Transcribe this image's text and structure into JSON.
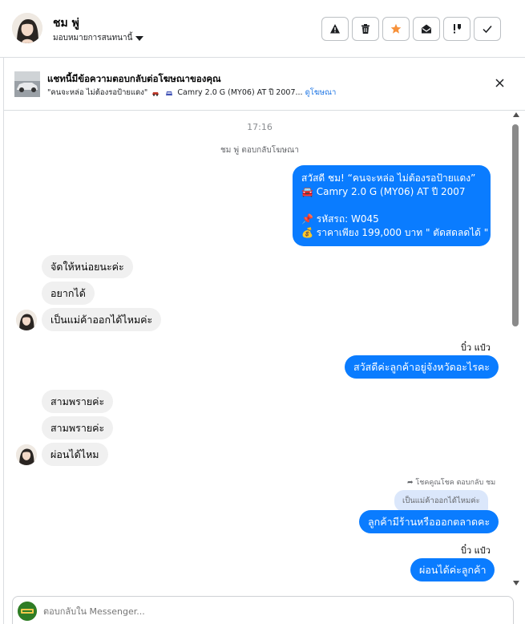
{
  "header": {
    "contact_name": "ชม พู่",
    "assign_label": "มอบหมายการสนทนานี้",
    "actions": [
      {
        "icon": "alert-triangle-icon",
        "name": "spam-button"
      },
      {
        "icon": "trash-icon",
        "name": "delete-button"
      },
      {
        "icon": "star-icon",
        "name": "star-button"
      },
      {
        "icon": "mark-unread-icon",
        "name": "mark-unread-button"
      },
      {
        "icon": "follow-up-icon",
        "name": "follow-up-button"
      },
      {
        "icon": "check-icon",
        "name": "done-button"
      }
    ],
    "star_color": "#f7923b"
  },
  "ad_banner": {
    "title": "แชทนี้มีข้อความตอบกลับต่อโฆษณาของคุณ",
    "subtitle": "\"คนจะหล่อ ไม่ต้องรอป้ายแดง\"",
    "subtitle_rest": "Camry 2.0 G (MY06) AT ปี 2007...",
    "link": "ดูโฆษณา"
  },
  "chat": {
    "time_label": "17:16",
    "replied_to_ad": "ชม พู่ ตอบกลับโฆษณา",
    "ad_message": "สวัสดี ชม! “คนจะหล่อ ไม่ต้องรอป้ายแดง”\n🚘 Camry 2.0 G (MY06) AT ปี 2007\n\n📌 รหัสรถ: W045\n💰 ราคาเพียง 199,000 บาท \" ตัดสดลดได้ \"",
    "group1": [
      "จัดให้หน่อยนะค่ะ",
      "อยากได้",
      "เป็นแม่ค้าออกได้ไหมค่ะ"
    ],
    "agent_name_1": "บิ๋ว แป๋ว",
    "agent_msg_1": "สวัสดีค่ะลูกค้าอยู่จังหวัดอะไรคะ",
    "group2": [
      "สามพรายค่ะ",
      "สามพรายค่ะ",
      "ผ่อนได้ไหม"
    ],
    "reply_meta": "โชคคูณโชค ตอบกลับ ชม",
    "quoted_text": "เป็นแม่ค้าออกได้ไหมค่ะ",
    "reply_msg": "ลูกค้ามีร้านหรือออกตลาดคะ",
    "agent_name_2": "บิ๋ว แป๋ว",
    "agent_msg_2": "ผ่อนได้ค่ะลูกค้า"
  },
  "composer": {
    "placeholder": "ตอบกลับใน Messenger..."
  },
  "colors": {
    "outgoing": "#0a7cff",
    "incoming": "#f0f0f0",
    "link": "#1b74e4"
  }
}
